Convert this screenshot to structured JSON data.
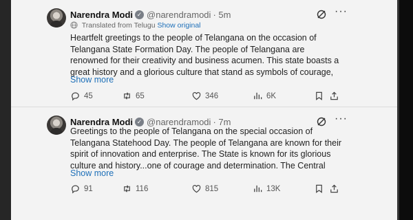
{
  "tweets": [
    {
      "name": "Narendra Modi",
      "handle": "@narendramodi",
      "time": "· 5m",
      "translated_label": "Translated from Telugu",
      "show_original": "Show original",
      "text": "Heartfelt greetings to the people of Telangana on the occasion of Telangana State Formation Day. The people of Telangana are renowned for their creativity and business acumen. This state boasts a great history and a glorious culture that stand as symbols of courage,",
      "show_more": "Show more",
      "replies": "45",
      "retweets": "65",
      "likes": "346",
      "views": "6K"
    },
    {
      "name": "Narendra Modi",
      "handle": "@narendramodi",
      "time": "· 7m",
      "text": "Greetings to the people of Telangana on the special occasion of Telangana Statehood Day. The people of Telangana are known for their spirit of innovation and enterprise. The State is known for its glorious culture and history...one of courage and determination. The Central",
      "show_more": "Show more",
      "replies": "91",
      "retweets": "116",
      "likes": "815",
      "views": "13K"
    }
  ],
  "icons": {
    "verified": "verified-badge-icon",
    "grok": "grok-icon",
    "more": "more-icon",
    "translate": "globe-icon",
    "reply": "reply-icon",
    "retweet": "retweet-icon",
    "like": "heart-icon",
    "views": "views-icon",
    "bookmark": "bookmark-icon",
    "share": "share-icon"
  },
  "colors": {
    "link": "#1d6fb8",
    "text": "#222222",
    "muted": "#666666",
    "panel_bg": "#f3f3f3"
  }
}
